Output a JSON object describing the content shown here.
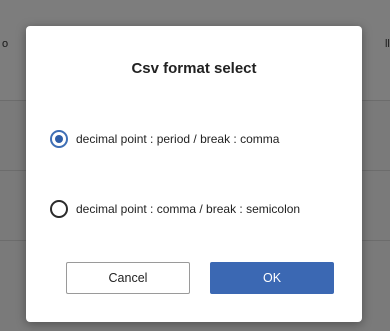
{
  "background": {
    "left_header_fragment": "o",
    "right_header_fragment": "lle"
  },
  "dialog": {
    "title": "Csv format select",
    "options": [
      {
        "label": "decimal point : period / break : comma",
        "checked": true
      },
      {
        "label": "decimal point : comma / break : semicolon",
        "checked": false
      }
    ],
    "cancel_label": "Cancel",
    "ok_label": "OK"
  },
  "colors": {
    "accent": "#3b68b3",
    "overlay": "#7d7d7d"
  }
}
